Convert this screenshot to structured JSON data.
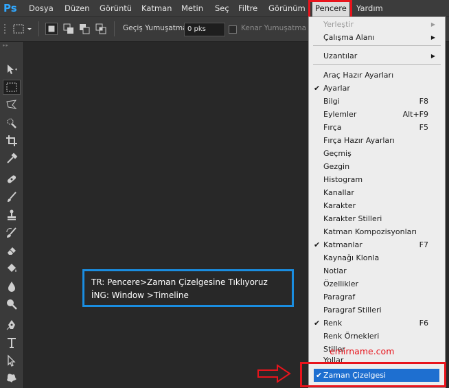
{
  "app": {
    "logo": "Ps"
  },
  "menubar": {
    "items": [
      {
        "label": "Dosya"
      },
      {
        "label": "Düzen"
      },
      {
        "label": "Görüntü"
      },
      {
        "label": "Katman"
      },
      {
        "label": "Metin"
      },
      {
        "label": "Seç"
      },
      {
        "label": "Filtre"
      },
      {
        "label": "Görünüm"
      },
      {
        "label": "Pencere"
      },
      {
        "label": "Yardım"
      }
    ],
    "active": "Pencere"
  },
  "options": {
    "feather_label": "Geçiş Yumuşatma:",
    "feather_value": "0 pks",
    "antialias_label": "Kenar Yumuşatma"
  },
  "note": {
    "line1": "TR: Pencere>Zaman Çizelgesine Tıklıyoruz",
    "line2": "İNG: Window >Timeline"
  },
  "watermark": "emirname.com",
  "window_menu": {
    "items": [
      {
        "label": "Yerleştir",
        "submenu": true,
        "disabled": true
      },
      {
        "label": "Çalışma Alanı",
        "submenu": true
      },
      {
        "label": "Uzantılar",
        "submenu": true
      },
      {
        "label": "Araç Hazır Ayarları"
      },
      {
        "label": "Ayarlar",
        "checked": true
      },
      {
        "label": "Bilgi",
        "shortcut": "F8"
      },
      {
        "label": "Eylemler",
        "shortcut": "Alt+F9"
      },
      {
        "label": "Fırça",
        "shortcut": "F5"
      },
      {
        "label": "Fırça Hazır Ayarları"
      },
      {
        "label": "Geçmiş"
      },
      {
        "label": "Gezgin"
      },
      {
        "label": "Histogram"
      },
      {
        "label": "Kanallar"
      },
      {
        "label": "Karakter"
      },
      {
        "label": "Karakter Stilleri"
      },
      {
        "label": "Katman Kompozisyonları"
      },
      {
        "label": "Katmanlar",
        "checked": true,
        "shortcut": "F7"
      },
      {
        "label": "Kaynağı Klonla"
      },
      {
        "label": "Notlar"
      },
      {
        "label": "Özellikler"
      },
      {
        "label": "Paragraf"
      },
      {
        "label": "Paragraf Stilleri"
      },
      {
        "label": "Renk",
        "checked": true,
        "shortcut": "F6"
      },
      {
        "label": "Renk Örnekleri"
      },
      {
        "label": "Stiller"
      },
      {
        "label": "Yollar"
      },
      {
        "label": "Zaman Çizelgesi",
        "checked": true,
        "highlighted": true
      }
    ]
  },
  "toolbar": {
    "tools": [
      {
        "icon": "move-tool-icon"
      },
      {
        "icon": "rectangular-marquee-icon",
        "active": true
      },
      {
        "icon": "polygonal-lasso-icon"
      },
      {
        "icon": "quick-selection-icon"
      },
      {
        "icon": "crop-tool-icon"
      },
      {
        "icon": "eyedropper-icon"
      },
      {
        "icon": "spot-healing-brush-icon"
      },
      {
        "icon": "brush-tool-icon"
      },
      {
        "icon": "clone-stamp-icon"
      },
      {
        "icon": "history-brush-icon"
      },
      {
        "icon": "eraser-tool-icon"
      },
      {
        "icon": "paint-bucket-icon"
      },
      {
        "icon": "blur-tool-icon"
      },
      {
        "icon": "dodge-tool-icon"
      },
      {
        "icon": "pen-tool-icon"
      },
      {
        "icon": "type-tool-icon"
      },
      {
        "icon": "path-selection-icon"
      },
      {
        "icon": "custom-shape-icon"
      }
    ]
  },
  "colors": {
    "highlight": "#1e6fd0",
    "annotation_red": "#e8141c",
    "annotation_blue": "#1a8de0"
  }
}
